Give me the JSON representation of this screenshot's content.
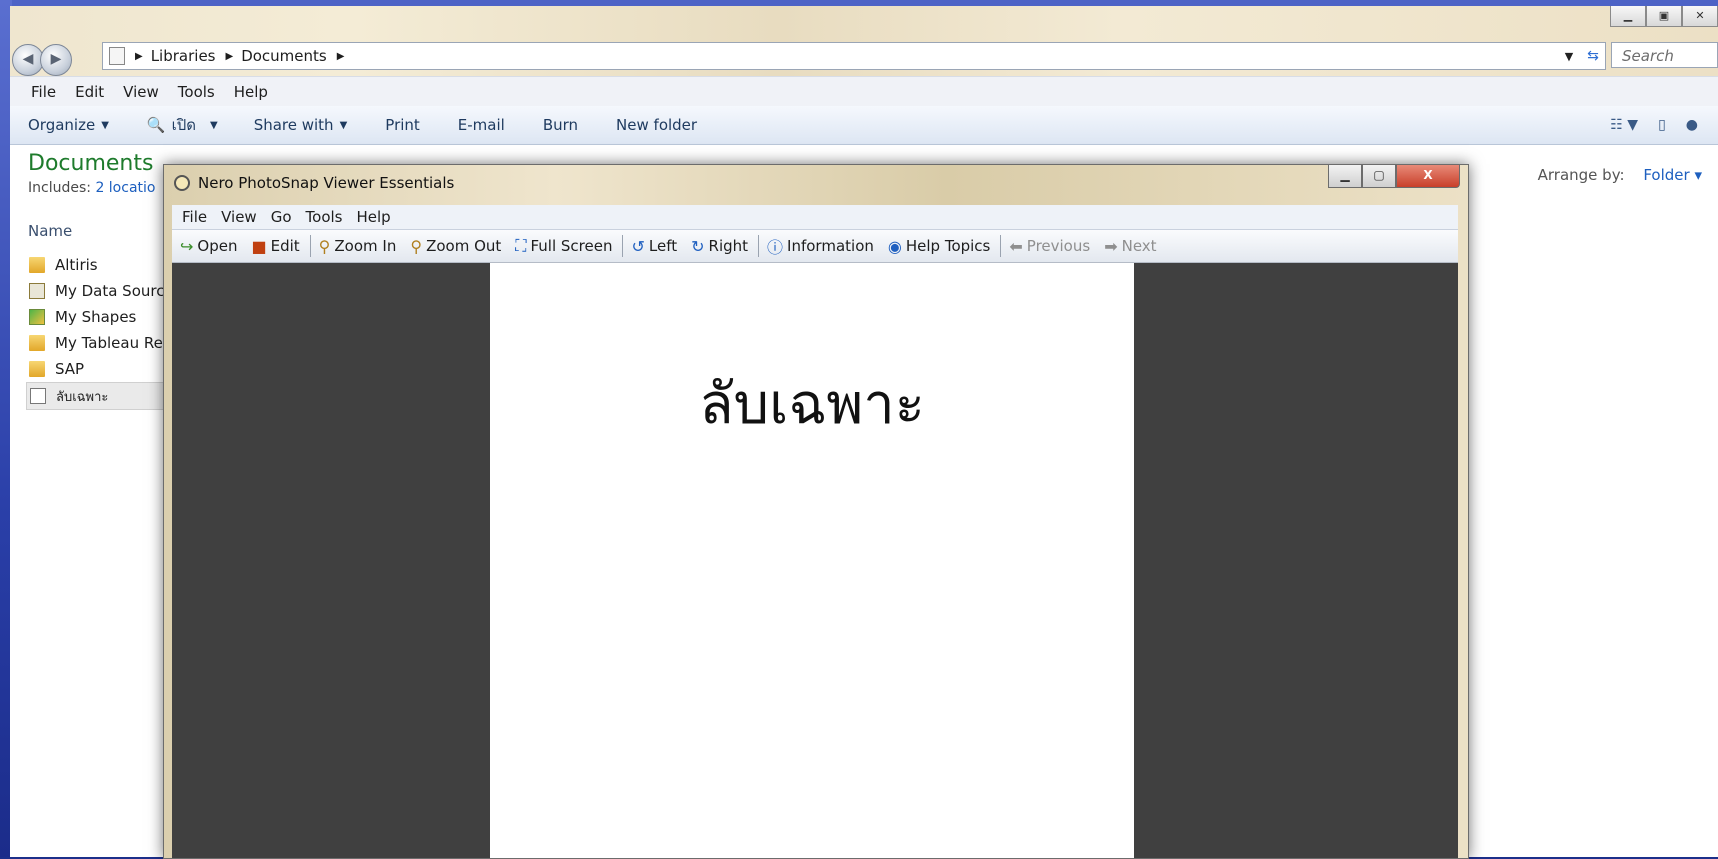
{
  "explorer": {
    "breadcrumb": [
      "Libraries",
      "Documents"
    ],
    "search_placeholder": "Search Doc...",
    "menu": [
      "File",
      "Edit",
      "View",
      "Tools",
      "Help"
    ],
    "commands": [
      "Organize",
      "เปิด",
      "Share with",
      "Print",
      "E-mail",
      "Burn",
      "New folder"
    ],
    "library_title": "Documents",
    "includes_label": "Includes:",
    "includes_link": "2 locatio",
    "arrange_label": "Arrange by:",
    "arrange_value": "Folder",
    "column_name": "Name",
    "files": [
      {
        "name": "Altiris",
        "icon": "folder-icon"
      },
      {
        "name": "My Data Sourc",
        "icon": "data-source-icon"
      },
      {
        "name": "My Shapes",
        "icon": "shapes-icon"
      },
      {
        "name": "My Tableau Re",
        "icon": "folder-icon"
      },
      {
        "name": "SAP",
        "icon": "folder-icon"
      },
      {
        "name": "ลับเฉพาะ",
        "icon": "document-icon"
      }
    ]
  },
  "viewer": {
    "title": "Nero PhotoSnap Viewer Essentials",
    "menu": [
      "File",
      "View",
      "Go",
      "Tools",
      "Help"
    ],
    "toolbar": {
      "open": "Open",
      "edit": "Edit",
      "zoom_in": "Zoom In",
      "zoom_out": "Zoom Out",
      "full_screen": "Full Screen",
      "left": "Left",
      "right": "Right",
      "information": "Information",
      "help_topics": "Help Topics",
      "previous": "Previous",
      "next": "Next"
    },
    "document_text": "ลับเฉพาะ"
  },
  "colors": {
    "library_title": "#1e7b2c",
    "link": "#1d5fbf",
    "viewer_background": "#404040",
    "close_button": "#c83f2a"
  }
}
